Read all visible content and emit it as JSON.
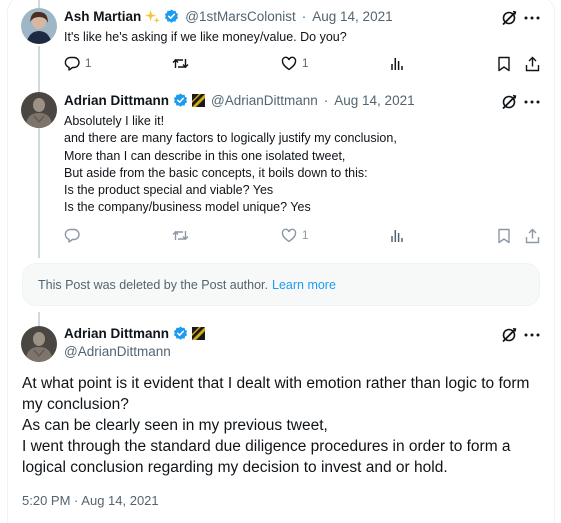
{
  "reply1": {
    "name": "Ash Martian",
    "handle": "@1stMarsColonist",
    "separator": "·",
    "date": "Aug 14, 2021",
    "text": "It's like he's asking if we like money/value. Do you?",
    "reply_count": "1",
    "like_count": "1"
  },
  "reply2": {
    "name": "Adrian Dittmann",
    "handle": "@AdrianDittmann",
    "separator": "·",
    "date": "Aug 14, 2021",
    "lines": [
      "Absolutely I like it!",
      "and there are many factors to logically justify my conclusion,",
      "More than I can describe in this one isolated tweet,",
      "But aside from the basic concepts, it boils down to this:",
      "Is the product special and viable? Yes",
      "Is the company/business model unique? Yes"
    ],
    "like_count": "1"
  },
  "deleted_notice": {
    "text": "This Post was deleted by the Post author.",
    "link": "Learn more"
  },
  "main": {
    "name": "Adrian Dittmann",
    "handle": "@AdrianDittmann",
    "lines": [
      "At what point is it evident that I dealt with emotion rather than logic to form my conclusion?",
      "As can be clearly seen in my previous tweet,",
      "I went through the standard due diligence procedures in order to form a logical conclusion regarding my decision to invest and or hold."
    ],
    "time": "5:20 PM",
    "separator": "·",
    "date": "Aug 14, 2021"
  },
  "colors": {
    "accent": "#1d9bf0",
    "verified": "#1d9bf0",
    "text": "#0f1419",
    "muted": "#536471"
  }
}
